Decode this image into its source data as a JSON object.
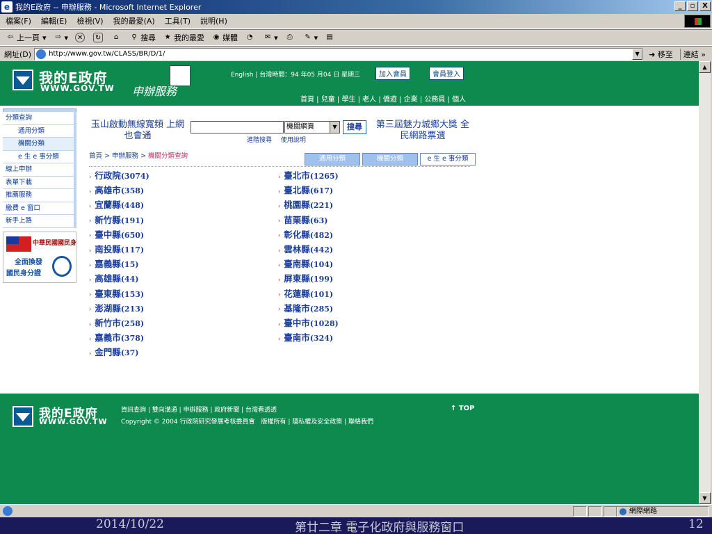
{
  "window": {
    "title": "我的E政府 -- 申辦服務 - Microsoft Internet Explorer",
    "min": "_",
    "max": "▫",
    "close": "X"
  },
  "menu": [
    "檔案(F)",
    "編輯(E)",
    "檢視(V)",
    "我的最愛(A)",
    "工具(T)",
    "說明(H)"
  ],
  "toolbar": {
    "back": "上一頁",
    "search": "搜尋",
    "favorites": "我的最愛",
    "media": "媒體"
  },
  "address": {
    "label": "網址(D)",
    "url": "http://www.gov.tw/CLASS/BR/D/1/",
    "go": "移至",
    "links": "連結 »"
  },
  "header": {
    "logo_cn": "我的E政府",
    "logo_en": "WWW.GOV.TW",
    "service": "申辦服務",
    "info": "English | 台灣時間：94 年05 月04 日 星期三",
    "join": "加入會員",
    "login": "會員登入",
    "nav": "首頁 | 兒童 | 學生 | 老人 | 僑遊 | 企業 | 公務員 | 個人"
  },
  "sidebar": {
    "items": [
      {
        "label": "分類查詢",
        "type": "top"
      },
      {
        "label": "通用分類",
        "type": "sub"
      },
      {
        "label": "機關分類",
        "type": "sub active"
      },
      {
        "label": "e 生 e 事分類",
        "type": "sub"
      },
      {
        "label": "線上申辦",
        "type": "top"
      },
      {
        "label": "表單下載",
        "type": "top"
      },
      {
        "label": "推薦服務",
        "type": "top"
      },
      {
        "label": "繳費 e 窗口",
        "type": "top"
      },
      {
        "label": "新手上路",
        "type": "top"
      }
    ],
    "banner_title": "中華民國國民身",
    "banner_line1": "全面換發",
    "banner_line2": "國民身分證"
  },
  "search": {
    "promo_left": "玉山啟動無線寬頻 上網也會通",
    "select_value": "機關網頁",
    "button": "搜尋",
    "advanced": "進階搜尋",
    "help": "使用說明",
    "promo_right": "第三屆魅力城鄉大獎 全民網路票選"
  },
  "breadcrumb": {
    "home": "首頁",
    "sep": " > ",
    "service": "申辦服務",
    "current": "機關分類查詢"
  },
  "tabs": [
    "通用分類",
    "機關分類",
    "e 生 e 事分類"
  ],
  "categories_left": [
    {
      "name": "行政院",
      "count": "(3074)"
    },
    {
      "name": "高雄市",
      "count": "(358)"
    },
    {
      "name": "宜蘭縣",
      "count": "(448)"
    },
    {
      "name": "新竹縣",
      "count": "(191)"
    },
    {
      "name": "臺中縣",
      "count": "(650)"
    },
    {
      "name": "南投縣",
      "count": "(117)"
    },
    {
      "name": "嘉義縣",
      "count": "(15)"
    },
    {
      "name": "高雄縣",
      "count": "(44)"
    },
    {
      "name": "臺東縣",
      "count": "(153)"
    },
    {
      "name": "澎湖縣",
      "count": "(213)"
    },
    {
      "name": "新竹市",
      "count": "(258)"
    },
    {
      "name": "嘉義市",
      "count": "(378)"
    },
    {
      "name": "金門縣",
      "count": "(37)"
    }
  ],
  "categories_right": [
    {
      "name": "臺北市",
      "count": "(1265)"
    },
    {
      "name": "臺北縣",
      "count": "(617)"
    },
    {
      "name": "桃園縣",
      "count": "(221)"
    },
    {
      "name": "苗栗縣",
      "count": "(63)"
    },
    {
      "name": "彰化縣",
      "count": "(482)"
    },
    {
      "name": "雲林縣",
      "count": "(442)"
    },
    {
      "name": "臺南縣",
      "count": "(104)"
    },
    {
      "name": "屏東縣",
      "count": "(199)"
    },
    {
      "name": "花蓮縣",
      "count": "(101)"
    },
    {
      "name": "基隆市",
      "count": "(285)"
    },
    {
      "name": "臺中市",
      "count": "(1028)"
    },
    {
      "name": "臺南市",
      "count": "(324)"
    }
  ],
  "footer": {
    "links": "資訊查詢 | 雙向溝通 | 申辦服務 | 政府新聞 | 台灣看透透",
    "copyright": "Copyright © 2004 行政院研究發展考核委員會　版權所有 | 隱私權及安全政策 | 聯絡我們",
    "top": "↑ TOP"
  },
  "status": {
    "zone": "網際網路"
  },
  "slide": {
    "date": "2014/10/22",
    "title": "第廿二章 電子化政府與服務窗口",
    "page": "12"
  },
  "colors": {
    "site_green": "#0f8a4f",
    "link_blue": "#1a3e9a",
    "slide_bg": "#1a1a5a"
  }
}
